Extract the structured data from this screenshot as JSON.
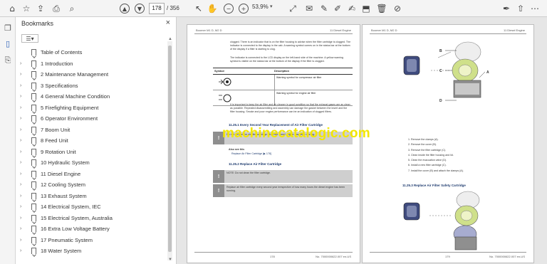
{
  "toolbar": {
    "current_page": "178",
    "total_pages": "/ 356",
    "zoom": "53,9%"
  },
  "panel": {
    "title": "Bookmarks",
    "options_icon": "options-icon",
    "close_glyph": "×"
  },
  "bookmarks": [
    {
      "label": "Table of Contents",
      "expandable": false
    },
    {
      "label": "1 Introduction",
      "expandable": true
    },
    {
      "label": "2 Maintenance Management",
      "expandable": true
    },
    {
      "label": "3 Specifications",
      "expandable": true
    },
    {
      "label": "4 General Machine Condition",
      "expandable": true
    },
    {
      "label": "5 Firefighting Equipment",
      "expandable": true
    },
    {
      "label": "6 Operator Environment",
      "expandable": true
    },
    {
      "label": "7 Boom Unit",
      "expandable": true
    },
    {
      "label": "8 Feed Unit",
      "expandable": true
    },
    {
      "label": "9 Rotation Unit",
      "expandable": true
    },
    {
      "label": "10 Hydraulic System",
      "expandable": true
    },
    {
      "label": "11 Diesel Engine",
      "expandable": true
    },
    {
      "label": "12 Cooling System",
      "expandable": true
    },
    {
      "label": "13 Exhaust System",
      "expandable": true
    },
    {
      "label": "14 Electrical System, IEC",
      "expandable": true
    },
    {
      "label": "15 Electrical System, Australia",
      "expandable": true
    },
    {
      "label": "16 Extra Low Voltage Battery",
      "expandable": true
    },
    {
      "label": "17 Pneumatic System",
      "expandable": true
    },
    {
      "label": "18 Water System",
      "expandable": true
    }
  ],
  "left_page": {
    "header_left": "Boomer M1 D, M2 D",
    "header_right": "11 Diesel Engine",
    "intro_text": "clogged. There is an indicator that is on the filter housing to advise when the filter cartridge is clogged. The indicator is connected to the display in the cab. A warning symbol comes on in the status bar at the bottom of the display if a filter is starting to clog.",
    "intro_text2": "The indicator is connected to the LCD display on the left-hand side of the machine. A yellow warning symbol is visible on the status bar at the bottom of the display if the filter is clogged.",
    "table_header_symbol": "Symbol",
    "table_header_desc": "Description",
    "row1_desc": "Warning symbol for compressor air filter",
    "row2_desc": "Warning symbol for engine air filter",
    "body_text": "It is important to keep the air filter and air cleaner in good condition so that the exhaust gases are as clean as possible. Repeated disassembling and assembly can damage the gasket between the insert and the filter housing. Smoke and poor engine performance can be an indication of clogged filters.",
    "section1": "11.25.1 Every Second Year Replacement of Air Filter Cartridge",
    "note1": "Do not service the air filter cartridge when the diesel engine has been running.",
    "also_see": "Also see this",
    "also_see_item": "Replace Air Filter Cartridge [▶ 178]",
    "section2": "11.25.2 Replace Air Filter Cartridge",
    "note2": "NOTE: Do not clean the filter cartridge.",
    "note3": "Replace air filter cartridge every second year irrespective of how many hours the diesel engine has been running.",
    "page_number": "178",
    "doc_number": "No. 7000000622.007 en-US"
  },
  "right_page": {
    "header_left": "Boomer M1 D, M2 D",
    "header_right": "11 Diesel Engine",
    "steps": [
      "1.   Remove the clamps (A).",
      "2.   Remove the cover (B).",
      "3.   Remove the filter cartridge (C).",
      "4.   Clean inside the filter housing and lid.",
      "5.   Clean the evacuation valve (D).",
      "6.   Install a new filter cartridge (C).",
      "7.   Install the cover (B) and attach the clamps (A)."
    ],
    "section3": "11.25.3 Replace Air Filter Safety Cartridge",
    "callouts": [
      "B",
      "A",
      "C",
      "D"
    ],
    "page_number": "179",
    "doc_number": "No. 7000000622.007 en-US"
  },
  "watermark": "machinecatalogic.com"
}
